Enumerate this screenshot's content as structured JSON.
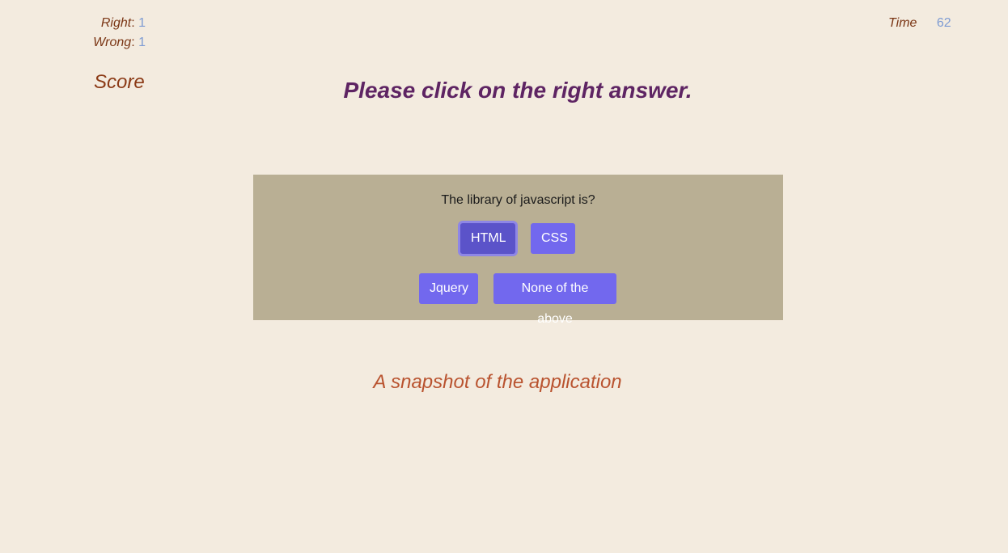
{
  "score_panel": {
    "right_label": "Right",
    "right_value": "1",
    "wrong_label": "Wrong",
    "wrong_value": "1",
    "heading": "Score"
  },
  "timer": {
    "label": "Time",
    "value": "62"
  },
  "instruction": "Please click on the right answer.",
  "quiz": {
    "question": "The library of javascript is?",
    "answers": [
      {
        "label": "HTML",
        "selected": true
      },
      {
        "label": "CSS",
        "selected": false
      },
      {
        "label": "Jquery",
        "selected": false
      },
      {
        "label": "None of the above",
        "selected": false
      }
    ]
  },
  "caption": "A snapshot of the application",
  "colors": {
    "background": "#f3ebdf",
    "card": "#b9af94",
    "button": "#7268ee",
    "button_selected": "#5b53c9",
    "instruction_text": "#5e2463",
    "label_text": "#7a3514",
    "value_text": "#7d9bd3",
    "caption_text": "#b9532f"
  }
}
